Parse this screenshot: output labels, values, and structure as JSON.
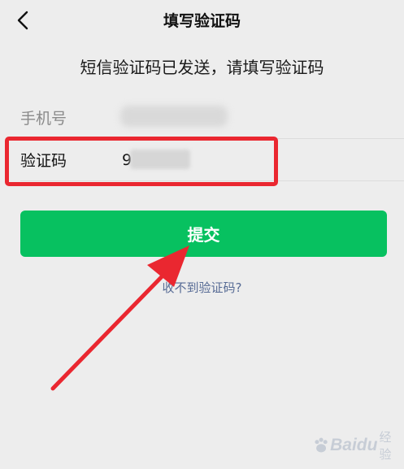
{
  "header": {
    "title": "填写验证码",
    "back_icon": "chevron-left-icon"
  },
  "subtitle": "短信验证码已发送，请填写验证码",
  "form": {
    "phone_label": "手机号",
    "code_label": "验证码",
    "code_value_visible": "9"
  },
  "submit_label": "提交",
  "help_link": "收不到验证码?",
  "watermark": {
    "brand": "Baidu",
    "suffix": "经验"
  },
  "colors": {
    "background": "#ededed",
    "primary": "#07c160",
    "link": "#576b95",
    "annotation_red": "#ea2730"
  }
}
